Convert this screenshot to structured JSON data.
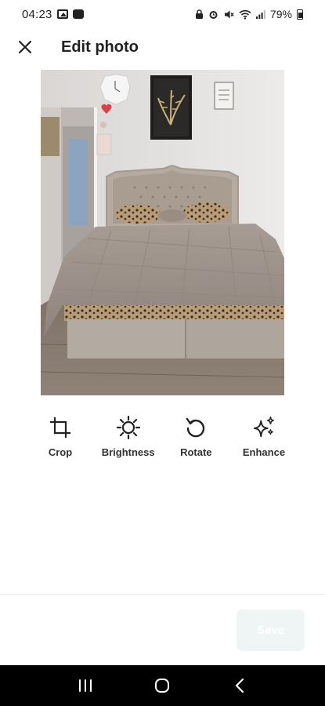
{
  "status_bar": {
    "time": "04:23",
    "battery_text": "79%",
    "icons": [
      "gallery-icon",
      "bag-icon",
      "lock-icon",
      "alarm-icon",
      "mute-icon",
      "wifi-icon",
      "signal-icon",
      "battery-icon"
    ]
  },
  "header": {
    "title": "Edit photo",
    "close_icon": "close-icon"
  },
  "photo": {
    "subject": "bedroom with upholstered bed"
  },
  "tools": [
    {
      "label": "Crop",
      "icon": "crop-icon"
    },
    {
      "label": "Brightness",
      "icon": "brightness-icon"
    },
    {
      "label": "Rotate",
      "icon": "rotate-icon"
    },
    {
      "label": "Enhance",
      "icon": "sparkles-icon"
    }
  ],
  "footer": {
    "save_label": "Save"
  },
  "colors": {
    "text": "#222222",
    "save_bg_disabled": "#eef5f4",
    "nav_bg": "#000000"
  }
}
